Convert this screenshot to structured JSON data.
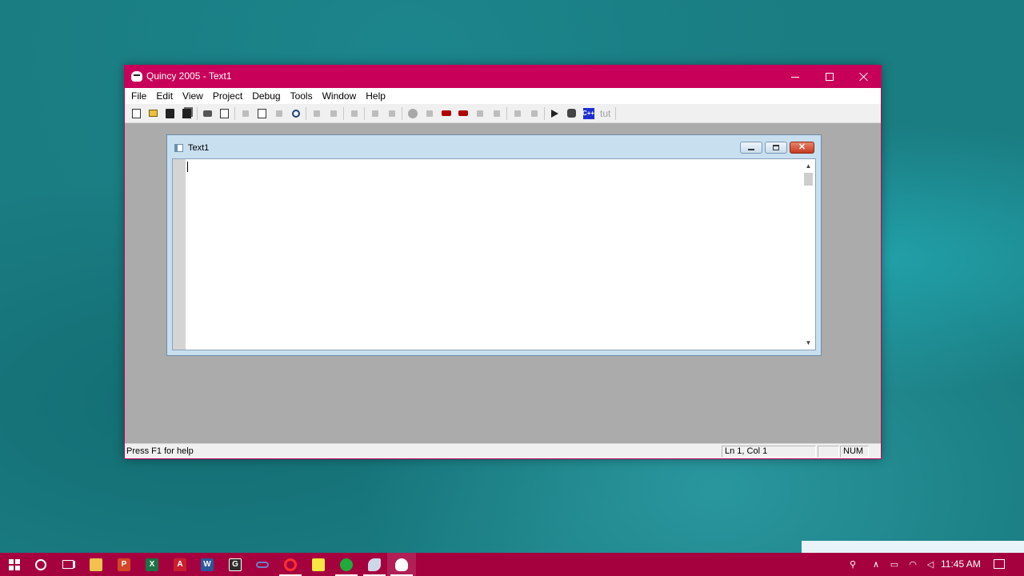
{
  "window": {
    "title": "Quincy 2005 - Text1",
    "controls": {
      "minimize": "minimize",
      "maximize": "maximize",
      "close": "close"
    }
  },
  "menu": [
    "File",
    "Edit",
    "View",
    "Project",
    "Debug",
    "Tools",
    "Window",
    "Help"
  ],
  "toolbar": {
    "buttons": [
      "new-icon",
      "open-icon",
      "save-icon",
      "save-all-icon",
      "print-icon",
      "print-preview-icon",
      "cut-icon",
      "copy-icon",
      "paste-icon",
      "find-icon",
      "undo-icon",
      "redo-icon",
      "select-icon",
      "indent-icon",
      "compile-icon",
      "breakpoint-icon",
      "step-icon",
      "run-icon",
      "debug-run-icon",
      "step-over-icon",
      "step-out-icon",
      "watch-icon",
      "hand-icon",
      "build-icon",
      "tutorial-icon",
      "cpp-icon"
    ],
    "tut_label": "tut"
  },
  "document": {
    "title": "Text1",
    "content": ""
  },
  "status": {
    "help": "Press F1 for help",
    "position": "Ln 1, Col 1",
    "blank": "",
    "num": "NUM"
  },
  "taskbar": {
    "apps": [
      "start-icon",
      "cortana-icon",
      "task-view-icon",
      "file-explorer-icon",
      "powerpoint-icon",
      "excel-icon",
      "acrobat-icon",
      "word-icon",
      "g-app-icon",
      "link-app-icon",
      "opera-icon",
      "sticky-notes-icon",
      "green-app-icon",
      "fish-app-icon",
      "quincy-icon"
    ],
    "tray": [
      "people-icon",
      "chevron-up-icon",
      "battery-icon",
      "wifi-icon",
      "volume-muted-icon"
    ],
    "clock": "11:45 AM"
  },
  "colors": {
    "titlebar": "#c90059",
    "taskbar": "#a5013f",
    "desktop": "#1a7d82",
    "mdi_background": "#ababab"
  }
}
